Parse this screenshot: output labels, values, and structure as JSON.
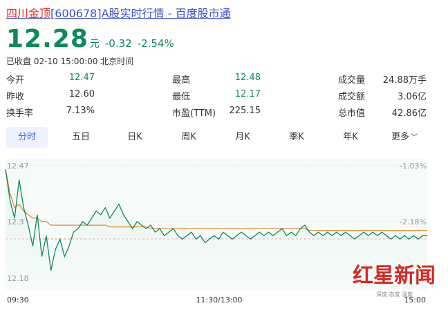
{
  "header": {
    "title_pre": "四川金顶",
    "title_post": "[600678]A股实时行情 - 百度股市通"
  },
  "quote": {
    "price": "12.28",
    "unit": "元",
    "change": "-0.32",
    "change_pct": "-2.54%",
    "status": "已收盘 02-10 15:00:00 北京时间"
  },
  "stats": [
    [
      {
        "label": "今开",
        "value": "12.47"
      },
      {
        "label": "最高",
        "value": "12.48"
      },
      {
        "label": "成交量",
        "value": "24.88万手"
      }
    ],
    [
      {
        "label": "昨收",
        "value": "12.60"
      },
      {
        "label": "最低",
        "value": "12.17"
      },
      {
        "label": "成交额",
        "value": "3.06亿"
      }
    ],
    [
      {
        "label": "换手率",
        "value": "7.13%"
      },
      {
        "label": "市盈(TTM)",
        "value": "225.15"
      },
      {
        "label": "总市值",
        "value": "42.86亿"
      }
    ]
  ],
  "tabs": [
    "分时",
    "五日",
    "日K",
    "周K",
    "月K",
    "季K",
    "年K",
    "更多"
  ],
  "active_tab": 0,
  "colors": {
    "up_down": "#0c8a5a",
    "avg_line": "#e88a2d",
    "link": "#3b4fd6",
    "brand_red": "#d42a24"
  },
  "chart_data": {
    "type": "line",
    "x_ticks": [
      "09:30",
      "11:30/13:00",
      "15:00"
    ],
    "y_left_ticks": [
      "12.47",
      "12.3",
      "12.18"
    ],
    "y_right_ticks": [
      "-1.03%",
      "-2.18%"
    ],
    "ylim": [
      12.16,
      12.48
    ],
    "prev_close": 12.6,
    "series": [
      {
        "values": [
          12.47,
          12.38,
          12.33,
          12.44,
          12.36,
          12.31,
          12.25,
          12.34,
          12.22,
          12.28,
          12.18,
          12.24,
          12.27,
          12.22,
          12.25,
          12.29,
          12.3,
          12.32,
          12.31,
          12.33,
          12.35,
          12.34,
          12.36,
          12.33,
          12.35,
          12.37,
          12.34,
          12.32,
          12.3,
          12.32,
          12.31,
          12.3,
          12.31,
          12.29,
          12.3,
          12.28,
          12.29,
          12.3,
          12.28,
          12.27,
          12.28,
          12.29,
          12.27,
          12.28,
          12.26,
          12.27,
          12.28,
          12.27,
          12.29,
          12.28,
          12.27,
          12.28,
          12.29,
          12.28,
          12.27,
          12.28,
          12.29,
          12.28,
          12.29,
          12.28,
          12.29,
          12.3,
          12.28,
          12.29,
          12.28,
          12.3,
          12.31,
          12.29,
          12.28,
          12.29,
          12.28,
          12.29,
          12.28,
          12.29,
          12.28,
          12.29,
          12.28,
          12.27,
          12.28,
          12.29,
          12.28,
          12.29,
          12.28,
          12.29,
          12.28,
          12.27,
          12.28,
          12.27,
          12.28,
          12.27,
          12.28,
          12.27,
          12.28,
          12.28
        ]
      },
      {
        "values": [
          12.47,
          12.4,
          12.36,
          12.37,
          12.35,
          12.34,
          12.33,
          12.33,
          12.32,
          12.32,
          12.31,
          12.31,
          12.31,
          12.31,
          12.31,
          12.31,
          12.31,
          12.31,
          12.31,
          12.31,
          12.31,
          12.31,
          12.31,
          12.305,
          12.305,
          12.305,
          12.305,
          12.305,
          12.305,
          12.305,
          12.305,
          12.305,
          12.3,
          12.3,
          12.3,
          12.3,
          12.3,
          12.3,
          12.3,
          12.3,
          12.3,
          12.3,
          12.3,
          12.3,
          12.3,
          12.3,
          12.3,
          12.3,
          12.3,
          12.3,
          12.3,
          12.3,
          12.3,
          12.3,
          12.3,
          12.3,
          12.3,
          12.3,
          12.3,
          12.3,
          12.3,
          12.3,
          12.3,
          12.3,
          12.3,
          12.3,
          12.3,
          12.295,
          12.295,
          12.295,
          12.295,
          12.295,
          12.295,
          12.295,
          12.295,
          12.295,
          12.295,
          12.295,
          12.295,
          12.295,
          12.295,
          12.295,
          12.295,
          12.295,
          12.295,
          12.295,
          12.295,
          12.295,
          12.295,
          12.295,
          12.295,
          12.295,
          12.295,
          12.295
        ]
      }
    ]
  },
  "watermark": {
    "title": "红星新闻",
    "subtitle": "深度 态度 温度"
  }
}
